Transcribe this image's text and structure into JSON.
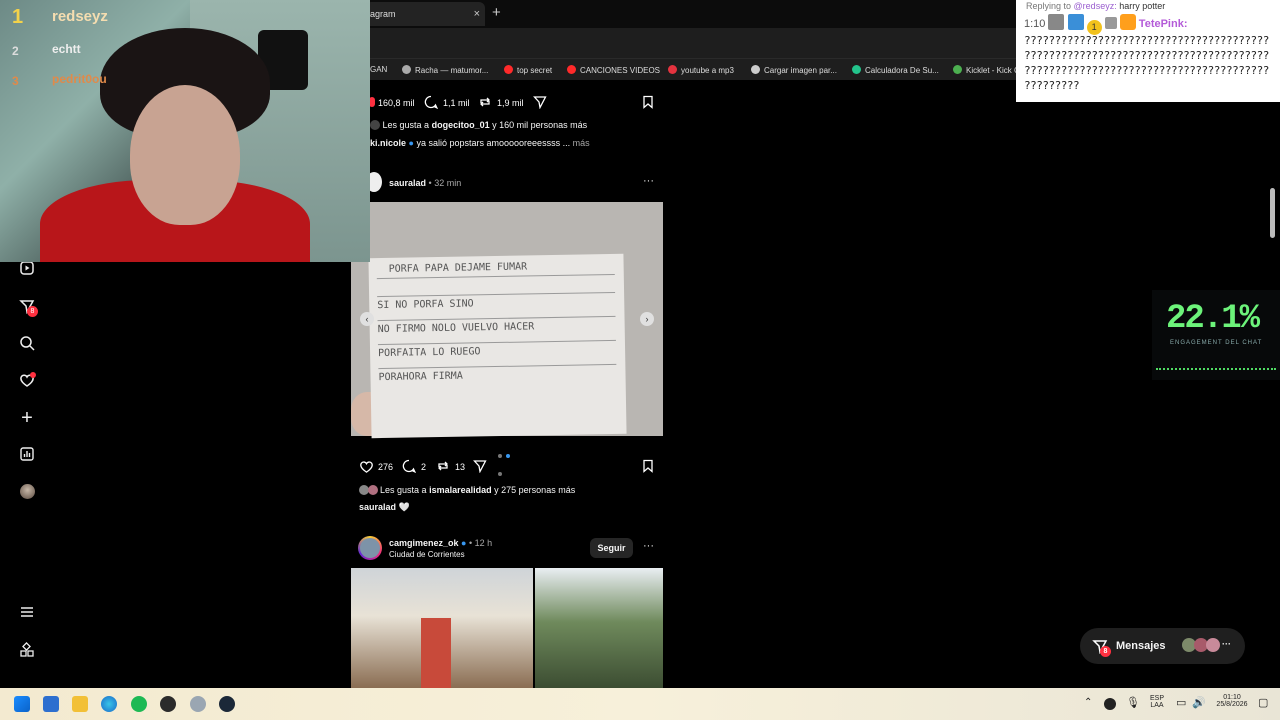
{
  "browser": {
    "tab_title": "agram",
    "tab_close": "×",
    "new_tab": "+",
    "bookmarks": [
      {
        "label": "GAN",
        "color": ""
      },
      {
        "label": "Racha — matumor...",
        "color": "#aaaaaa"
      },
      {
        "label": "top secret",
        "color": "#ff2a2a"
      },
      {
        "label": "CANCIONES VIDEOS",
        "color": "#ff2a2a"
      },
      {
        "label": "youtube a mp3",
        "color": "#e5333f"
      },
      {
        "label": "Cargar imagen par...",
        "color": "#cccccc"
      },
      {
        "label": "Calculadora De Su...",
        "color": "#23c48c"
      },
      {
        "label": "Kicklet - Kick C",
        "color": "#4caf50"
      }
    ]
  },
  "stream_overlay": {
    "rank1": "1",
    "rank1_name": "redseyz",
    "rank2": "2",
    "rank2_name": "echtt",
    "rank3": "3",
    "rank3_name": "pedrit0ou"
  },
  "sidebar": {
    "items": [
      {
        "icon": "reels-icon",
        "glyph": "▶"
      },
      {
        "icon": "messages-icon",
        "glyph": "✈",
        "badge": "8"
      },
      {
        "icon": "search-icon",
        "glyph": "⌕"
      },
      {
        "icon": "notifications-icon",
        "glyph": "♡"
      },
      {
        "icon": "create-icon",
        "glyph": "+"
      },
      {
        "icon": "dashboard-icon",
        "glyph": "▦"
      },
      {
        "icon": "profile-avatar",
        "glyph": "●"
      },
      {
        "icon": "menu-icon",
        "glyph": "≡"
      },
      {
        "icon": "more-icon",
        "glyph": "⁂"
      }
    ]
  },
  "feed": {
    "post1": {
      "likes": "160,8 mil",
      "comments": "1,1 mil",
      "reposts": "1,9 mil",
      "liked_by_prefix": "Les gusta a",
      "liked_by_user": "dogecitoo_01",
      "liked_by_suffix": "y 160 mil personas más",
      "caption_user": "ki.nicole",
      "caption_text": "ya salió popstars amoooooreeessss ...",
      "caption_more": "más"
    },
    "post2": {
      "user": "sauralad",
      "time": "32 min",
      "dots": "···",
      "likes": "276",
      "comments": "2",
      "reposts": "13",
      "liked_by_prefix": "Les gusta a",
      "liked_by_user": "ismalarealidad",
      "liked_by_suffix": "y 275 personas más",
      "caption_user": "sauralad",
      "caption_text": "🤍",
      "note_lines": [
        "PORFA PAPA DEJAME FUMAR",
        "SI NO  PORFA  SINO",
        "NO FIRMO  NOLO VUELVO HACER",
        "PORFAITA  LO RUEGO",
        "PORAHORA  FIRMA"
      ]
    },
    "post3": {
      "user": "camgimenez_ok",
      "time": "12 h",
      "location": "Ciudad de Corrientes",
      "follow": "Seguir",
      "dots": "···"
    }
  },
  "chat": {
    "reply_prefix": "Replying to",
    "reply_user": "@redseyz:",
    "reply_text": "harry potter",
    "time": "1:10",
    "user": "TetePink:",
    "message": "?????????????????????????????????????????????????????????????????????????????????????????????????????????????????????????????????",
    "badge": "1"
  },
  "engagement": {
    "value": "22.1%",
    "label": "ENGAGEMENT DEL CHAT"
  },
  "messages_pill": {
    "label": "Mensajes",
    "badge": "8",
    "more": "···"
  },
  "taskbar": {
    "lang1": "ESP",
    "lang2": "LAA",
    "time": "01:10",
    "date": "25/8/2026"
  }
}
